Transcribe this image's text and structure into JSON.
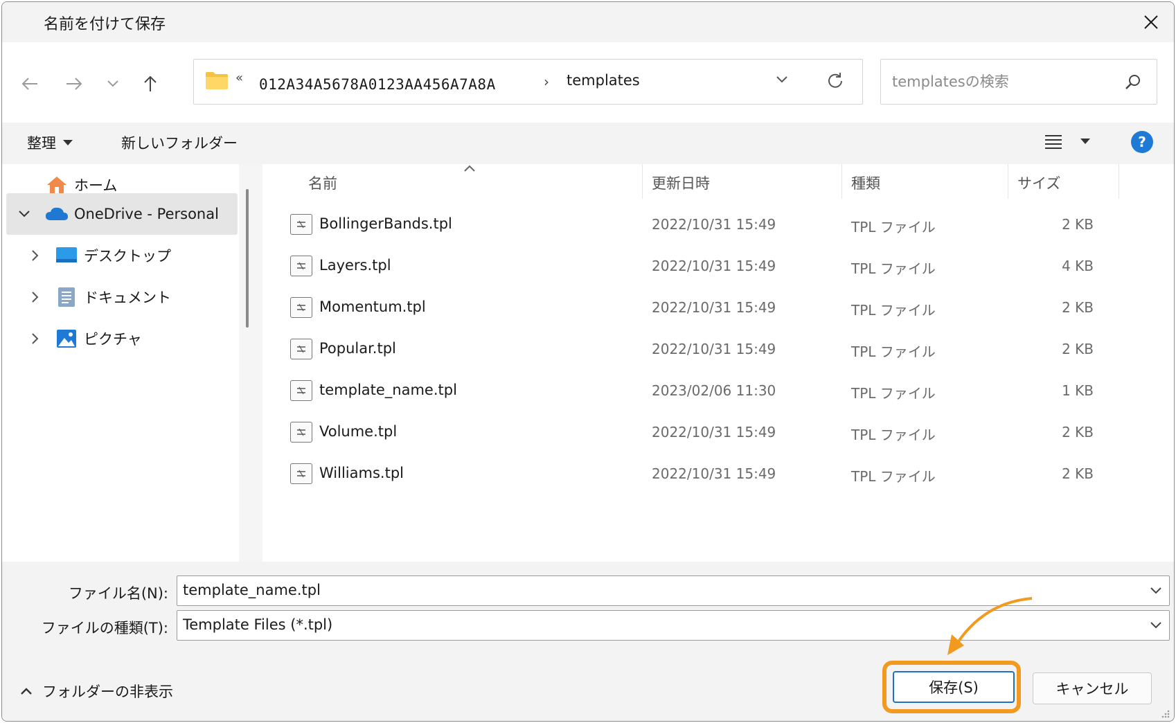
{
  "window": {
    "title": "名前を付けて保存"
  },
  "address": {
    "overflow": "«",
    "segments": [
      "012A34A5678A0123AA456A7A8A",
      "templates"
    ]
  },
  "search": {
    "placeholder": "templatesの検索"
  },
  "toolbar": {
    "organize_label": "整理",
    "new_folder_label": "新しいフォルダー"
  },
  "sidebar": {
    "items": [
      {
        "label": "ホーム",
        "icon": "home-icon"
      },
      {
        "label": "OneDrive - Personal",
        "icon": "cloud-icon",
        "selected": true
      },
      {
        "label": "デスクトップ",
        "icon": "desktop-icon"
      },
      {
        "label": "ドキュメント",
        "icon": "documents-icon"
      },
      {
        "label": "ピクチャ",
        "icon": "pictures-icon"
      }
    ]
  },
  "columns": {
    "name": "名前",
    "date": "更新日時",
    "type": "種類",
    "size": "サイズ"
  },
  "files": [
    {
      "name": "BollingerBands.tpl",
      "date": "2022/10/31 15:49",
      "type": "TPL ファイル",
      "size": "2 KB"
    },
    {
      "name": "Layers.tpl",
      "date": "2022/10/31 15:49",
      "type": "TPL ファイル",
      "size": "4 KB"
    },
    {
      "name": "Momentum.tpl",
      "date": "2022/10/31 15:49",
      "type": "TPL ファイル",
      "size": "2 KB"
    },
    {
      "name": "Popular.tpl",
      "date": "2022/10/31 15:49",
      "type": "TPL ファイル",
      "size": "2 KB"
    },
    {
      "name": "template_name.tpl",
      "date": "2023/02/06 11:30",
      "type": "TPL ファイル",
      "size": "1 KB"
    },
    {
      "name": "Volume.tpl",
      "date": "2022/10/31 15:49",
      "type": "TPL ファイル",
      "size": "2 KB"
    },
    {
      "name": "Williams.tpl",
      "date": "2022/10/31 15:49",
      "type": "TPL ファイル",
      "size": "2 KB"
    }
  ],
  "form": {
    "filename_label": "ファイル名(N):",
    "filename_value": "template_name.tpl",
    "filetype_label": "ファイルの種類(T):",
    "filetype_value": "Template Files (*.tpl)"
  },
  "footer": {
    "hide_folders_label": "フォルダーの非表示",
    "save_label": "保存(S)",
    "cancel_label": "キャンセル"
  },
  "colors": {
    "accent": "#1f6fc5",
    "highlight": "#f29a1f",
    "help": "#1f7ad6",
    "folder": "#f5c242"
  }
}
